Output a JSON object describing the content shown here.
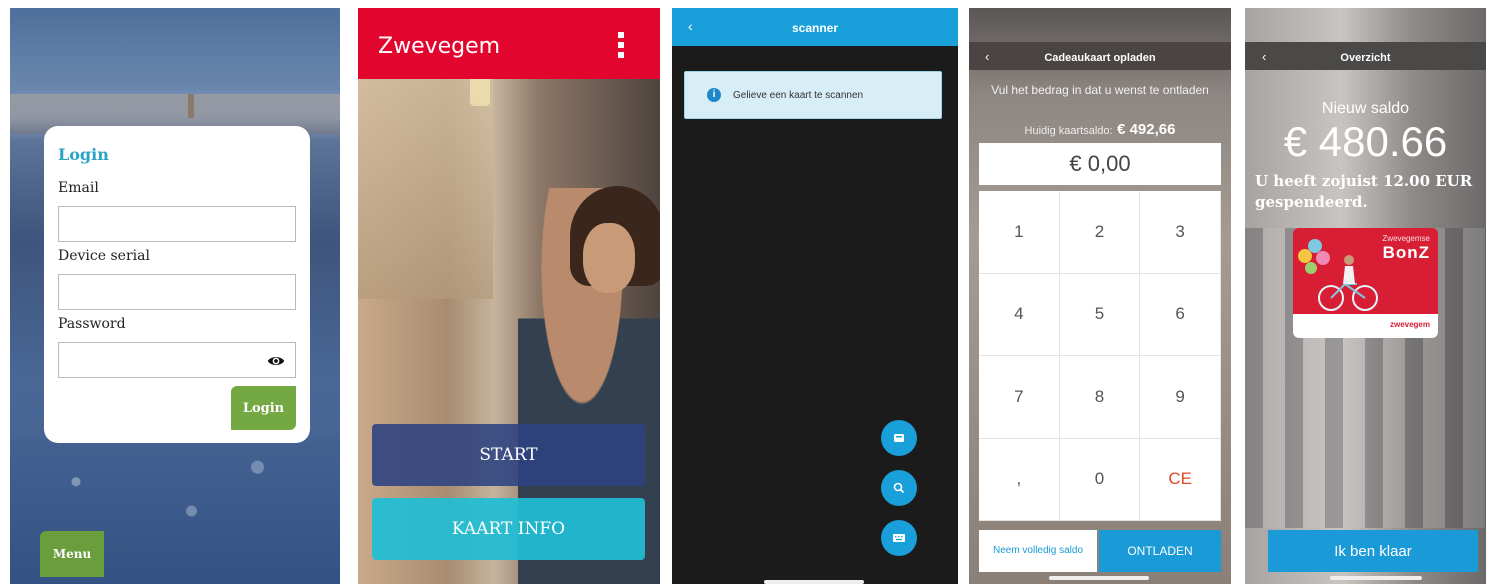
{
  "login_screen": {
    "title": "Login",
    "email_label": "Email",
    "email_value": "",
    "serial_label": "Device serial",
    "serial_value": "",
    "password_label": "Password",
    "password_value": "",
    "login_button": "Login",
    "menu_button": "Menu",
    "eye_icon": "eye-icon",
    "accent_color": "#2ba3c8",
    "button_color": "#74a842"
  },
  "home_screen": {
    "app_title": "Zwevegem",
    "menu_icon": "kebab-menu-icon",
    "start_button": "START",
    "card_info_button": "KAART INFO",
    "header_color": "#e2062f"
  },
  "scanner_screen": {
    "back": "‹",
    "title": "scanner",
    "info_icon": "info-icon",
    "info_text": "Gelieve een kaart te scannen",
    "fab_icons": [
      "card-icon",
      "search-icon",
      "keyboard-icon"
    ],
    "header_color": "#19a0da"
  },
  "topup_screen": {
    "back": "‹",
    "title": "Cadeaukaart opladen",
    "prompt": "Vul het bedrag in dat u wenst te ontladen",
    "balance_label": "Huidig kaartsaldo:",
    "balance_value": "€ 492,66",
    "amount": "€ 0,00",
    "keys": [
      "1",
      "2",
      "3",
      "4",
      "5",
      "6",
      "7",
      "8",
      "9",
      ",",
      "0",
      "CE"
    ],
    "full_balance_button": "Neem volledig saldo",
    "unload_button": "ONTLADEN"
  },
  "overview_screen": {
    "back": "‹",
    "title": "Overzicht",
    "new_balance_label": "Nieuw saldo",
    "new_balance": "€ 480.66",
    "spent_message": "U heeft zojuist 12.00 EUR gespendeerd.",
    "card_small_text": "Zwevegemse",
    "card_brand": "BonZ",
    "card_logo_text": "zwevegem",
    "done_button": "Ik ben klaar"
  }
}
